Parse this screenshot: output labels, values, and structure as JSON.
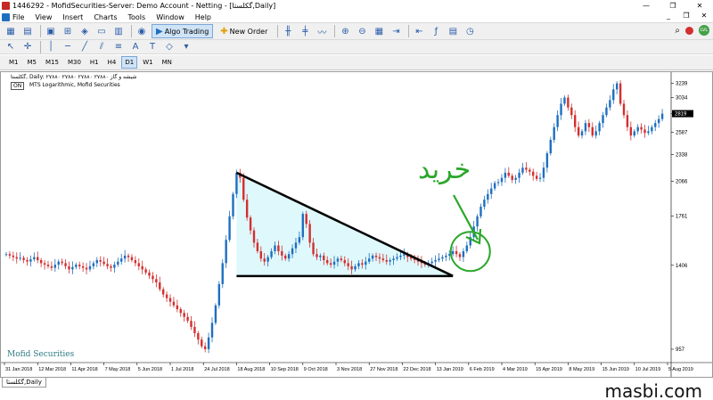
{
  "window": {
    "title": "1446292 - MofidSecurities-Server: Demo Account - Netting - [گکلستا,Daily]",
    "min": "—",
    "max": "❐",
    "close": "✕"
  },
  "menu": {
    "items": [
      "File",
      "View",
      "Insert",
      "Charts",
      "Tools",
      "Window",
      "Help"
    ],
    "mdi_min": "_",
    "mdi_restore": "❐",
    "mdi_close": "✕"
  },
  "toolbar": {
    "algo_trading": "Algo Trading",
    "new_order": "New Order",
    "lvl_badge": "LVL"
  },
  "timeframes": [
    "M1",
    "M5",
    "M15",
    "M30",
    "H1",
    "H4",
    "D1",
    "W1",
    "MN"
  ],
  "active_timeframe": "D1",
  "chart": {
    "header": "گکلستا, Daily:  ۲۷۸۸۰ ۲۷۸۸۰ ۲۷۸۸۰ ۲۷۸۸۰  شیشه و گاز",
    "indicator": "MTS Logarithmic, Mofid Securities",
    "on_label": "ON",
    "broker_watermark": "Mofid Securities",
    "buy_annotation": "خرید",
    "colors": {
      "bull": "#1e6fc0",
      "bear": "#d32f2f",
      "triangle_fill": "#dff8fb",
      "annotation": "#2aa72a"
    }
  },
  "chart_data": {
    "type": "candlestick",
    "price_scale": "logarithmic",
    "y_ticks": [
      "3239",
      "3034",
      "2819",
      "2587",
      "2338",
      "2066",
      "1761",
      "1406",
      "957"
    ],
    "x_ticks": [
      "31 Jan 2018",
      "12 Mar 2018",
      "11 Apr 2018",
      "7 May 2018",
      "5 Jun 2018",
      "1 Jul 2018",
      "24 Jul 2018",
      "18 Aug 2018",
      "10 Sep 2018",
      "9 Oct 2018",
      "3 Nov 2018",
      "27 Nov 2018",
      "22 Dec 2018",
      "13 Jan 2019",
      "6 Feb 2019",
      "4 Mar 2019",
      "15 Apr 2019",
      "8 May 2019",
      "15 Jun 2019",
      "10 Jul 2019",
      "5 Aug 2019"
    ],
    "current_price_label": "2819",
    "closes": [
      1480,
      1470,
      1460,
      1450,
      1455,
      1440,
      1430,
      1445,
      1460,
      1440,
      1420,
      1410,
      1400,
      1390,
      1410,
      1430,
      1420,
      1400,
      1380,
      1395,
      1410,
      1400,
      1390,
      1380,
      1400,
      1420,
      1440,
      1430,
      1415,
      1400,
      1390,
      1410,
      1430,
      1450,
      1470,
      1460,
      1440,
      1420,
      1400,
      1380,
      1360,
      1340,
      1320,
      1300,
      1260,
      1230,
      1210,
      1190,
      1170,
      1150,
      1130,
      1110,
      1090,
      1060,
      1030,
      1000,
      970,
      957,
      1010,
      1080,
      1170,
      1290,
      1420,
      1580,
      1760,
      1950,
      2150,
      2100,
      1900,
      1750,
      1650,
      1560,
      1500,
      1450,
      1430,
      1460,
      1500,
      1540,
      1500,
      1470,
      1450,
      1480,
      1520,
      1560,
      1600,
      1780,
      1700,
      1560,
      1480,
      1460,
      1470,
      1440,
      1420,
      1410,
      1430,
      1450,
      1440,
      1420,
      1400,
      1380,
      1400,
      1420,
      1410,
      1430,
      1450,
      1470,
      1460,
      1450,
      1440,
      1430,
      1440,
      1450,
      1460,
      1470,
      1480,
      1460,
      1450,
      1440,
      1430,
      1420,
      1410,
      1420,
      1430,
      1440,
      1450,
      1460,
      1470,
      1480,
      1500,
      1480,
      1460,
      1500,
      1540,
      1600,
      1680,
      1760,
      1840,
      1900,
      1950,
      2000,
      2050,
      2060,
      2100,
      2150,
      2120,
      2080,
      2100,
      2150,
      2200,
      2180,
      2160,
      2120,
      2090,
      2100,
      2200,
      2350,
      2500,
      2650,
      2800,
      2950,
      3034,
      2900,
      2800,
      2650,
      2550,
      2600,
      2700,
      2650,
      2550,
      2600,
      2700,
      2800,
      2900,
      3000,
      3150,
      3239,
      2950,
      2800,
      2650,
      2550,
      2600,
      2650,
      2620,
      2580,
      2600,
      2650,
      2700,
      2750,
      2819
    ],
    "annotations": {
      "triangle_apex_from": "10 Sep 2018",
      "triangle_apex_to": "6 Feb 2019",
      "triangle_upper_start_price": 2150,
      "triangle_base_price": 1406,
      "buy_circle_date": "4 Mar 2019",
      "buy_circle_price": 1480
    }
  },
  "tab": {
    "label": "گکلستا,Daily"
  },
  "site_watermark": "masbi.com"
}
